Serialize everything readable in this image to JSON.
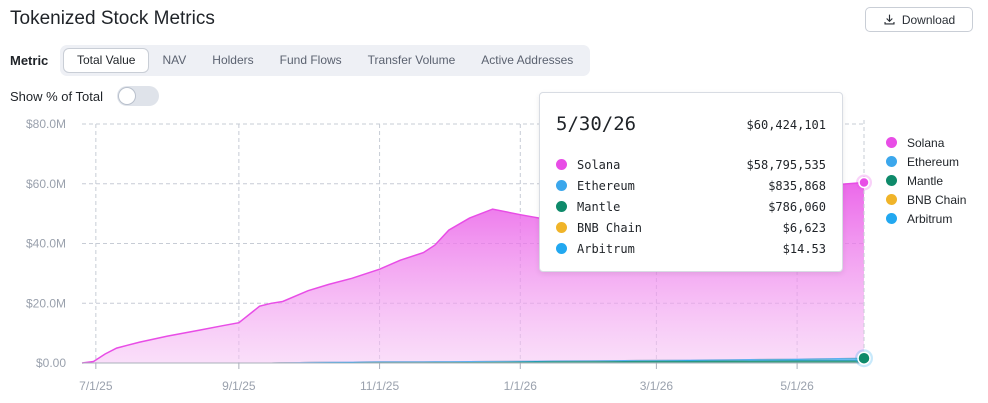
{
  "header": {
    "title": "Tokenized Stock Metrics",
    "download_label": "Download"
  },
  "controls": {
    "metric_label": "Metric",
    "tabs": [
      {
        "label": "Total Value",
        "active": true
      },
      {
        "label": "NAV",
        "active": false
      },
      {
        "label": "Holders",
        "active": false
      },
      {
        "label": "Fund Flows",
        "active": false
      },
      {
        "label": "Transfer Volume",
        "active": false
      },
      {
        "label": "Active Addresses",
        "active": false
      }
    ],
    "toggle_label": "Show % of Total",
    "toggle_on": false
  },
  "tooltip": {
    "date": "5/30/26",
    "total": "$60,424,101",
    "rows": [
      {
        "name": "Solana",
        "value": "$58,795,535",
        "color": "#e84de6"
      },
      {
        "name": "Ethereum",
        "value": "$835,868",
        "color": "#3ba7ec"
      },
      {
        "name": "Mantle",
        "value": "$786,060",
        "color": "#0e8a6a"
      },
      {
        "name": "BNB Chain",
        "value": "$6,623",
        "color": "#f0b429"
      },
      {
        "name": "Arbitrum",
        "value": "$14.53",
        "color": "#22a8f0"
      }
    ]
  },
  "chart_data": {
    "type": "area",
    "stacked": true,
    "title": "",
    "xlabel": "",
    "ylabel": "",
    "ylim": [
      0,
      80000000
    ],
    "yticks": [
      0,
      20000000,
      40000000,
      60000000,
      80000000
    ],
    "ytick_labels": [
      "$0.00",
      "$20.0M",
      "$40.0M",
      "$60.0M",
      "$80.0M"
    ],
    "xticks": [
      "2025-07-01",
      "2025-09-01",
      "2025-11-01",
      "2026-01-01",
      "2026-03-01",
      "2026-05-01"
    ],
    "xtick_labels": [
      "7/1/25",
      "9/1/25",
      "11/1/25",
      "1/1/26",
      "3/1/26",
      "5/1/26"
    ],
    "x_range": [
      "2025-06-25",
      "2026-05-30"
    ],
    "grid": true,
    "legend_position": "right",
    "x": [
      "2025-06-25",
      "2025-06-30",
      "2025-07-05",
      "2025-07-10",
      "2025-07-20",
      "2025-08-01",
      "2025-08-15",
      "2025-08-25",
      "2025-09-01",
      "2025-09-10",
      "2025-09-15",
      "2025-09-20",
      "2025-10-01",
      "2025-10-10",
      "2025-10-20",
      "2025-11-01",
      "2025-11-10",
      "2025-11-20",
      "2025-11-25",
      "2025-12-01",
      "2025-12-10",
      "2025-12-20",
      "2026-01-01",
      "2026-01-15",
      "2026-02-01",
      "2026-02-15",
      "2026-03-01",
      "2026-03-15",
      "2026-04-01",
      "2026-04-15",
      "2026-05-01",
      "2026-05-15",
      "2026-05-30"
    ],
    "series": [
      {
        "name": "Solana",
        "color": "#e84de6",
        "values": [
          0,
          500000,
          3000000,
          5000000,
          7000000,
          9000000,
          11000000,
          12500000,
          13500000,
          19000000,
          20000000,
          20500000,
          24000000,
          26000000,
          28000000,
          31000000,
          34000000,
          36500000,
          39000000,
          44000000,
          48000000,
          51000000,
          49000000,
          47000000,
          45000000,
          46000000,
          48000000,
          50000000,
          53000000,
          55000000,
          56500000,
          58000000,
          58795535
        ]
      },
      {
        "name": "Ethereum",
        "color": "#3ba7ec",
        "values": [
          0,
          0,
          0,
          0,
          0,
          0,
          0,
          0,
          0,
          0,
          0,
          0,
          0,
          0,
          0,
          0,
          0,
          0,
          0,
          0,
          0,
          0,
          100000,
          150000,
          200000,
          250000,
          300000,
          350000,
          400000,
          500000,
          600000,
          700000,
          835868
        ]
      },
      {
        "name": "Mantle",
        "color": "#0e8a6a",
        "values": [
          0,
          0,
          0,
          0,
          0,
          0,
          0,
          0,
          0,
          0,
          0,
          100000,
          200000,
          300000,
          350000,
          400000,
          420000,
          440000,
          460000,
          480000,
          500000,
          520000,
          540000,
          560000,
          580000,
          600000,
          620000,
          650000,
          680000,
          710000,
          740000,
          760000,
          786060
        ]
      },
      {
        "name": "BNB Chain",
        "color": "#f0b429",
        "values": [
          0,
          0,
          0,
          0,
          0,
          0,
          0,
          0,
          0,
          0,
          0,
          0,
          0,
          0,
          0,
          0,
          0,
          0,
          0,
          0,
          0,
          0,
          0,
          0,
          0,
          1000,
          2000,
          3000,
          4000,
          5000,
          6000,
          6300,
          6623
        ]
      },
      {
        "name": "Arbitrum",
        "color": "#22a8f0",
        "values": [
          0,
          0,
          0,
          0,
          0,
          0,
          0,
          0,
          0,
          0,
          0,
          0,
          0,
          0,
          0,
          0,
          0,
          0,
          0,
          0,
          0,
          0,
          0,
          0,
          0,
          0,
          0,
          0,
          0,
          0,
          10,
          12,
          14.53
        ]
      }
    ],
    "highlight": {
      "x": "2026-05-30",
      "total": 60424101
    }
  }
}
